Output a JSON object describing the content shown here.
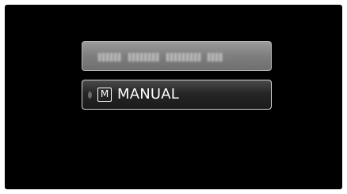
{
  "menu": {
    "items": [
      {
        "id": "auto",
        "label": "",
        "state": "unselected"
      },
      {
        "id": "manual",
        "icon_letter": "M",
        "label": "MANUAL",
        "state": "selected"
      }
    ]
  },
  "icons": {
    "manual_mode": "manual-mode-icon"
  },
  "colors": {
    "screen_background": "#000000",
    "selected_border": "#d8d8d8",
    "unselected_fill": "#8a8a8a",
    "text": "#ffffff"
  }
}
